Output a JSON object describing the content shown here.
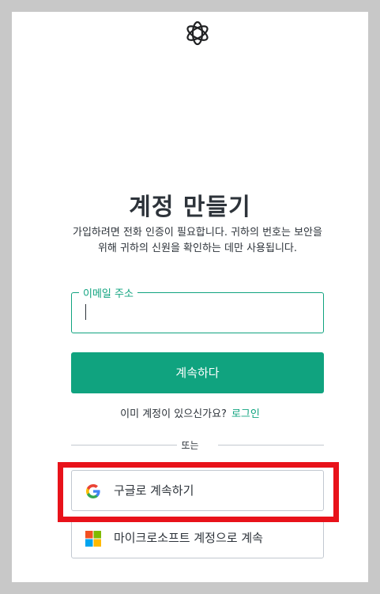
{
  "icons": {
    "logo": "openai-logo-icon",
    "google": "google-g-icon",
    "microsoft": "microsoft-logo-icon"
  },
  "colors": {
    "accent": "#10a37f",
    "text": "#2d333a",
    "border": "#c2c8d0",
    "highlight": "#e8121a"
  },
  "header": {
    "title": "계정 만들기",
    "description": "가입하려면 전화 인증이 필요합니다. 귀하의 번호는 보안을 위해 귀하의 신원을 확인하는 데만 사용됩니다."
  },
  "form": {
    "email_label": "이메일 주소",
    "email_value": "",
    "continue_label": "계속하다"
  },
  "login": {
    "prompt": "이미 계정이 있으신가요?",
    "link": "로그인"
  },
  "divider": {
    "text": "또는"
  },
  "social": {
    "google_label": "구글로 계속하기",
    "microsoft_label": "마이크로소프트 계정으로 계속"
  }
}
